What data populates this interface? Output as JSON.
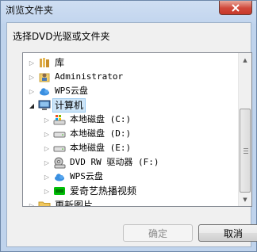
{
  "window": {
    "title": "浏览文件夹",
    "close_icon": "close-x"
  },
  "dialog": {
    "instruction": "选择DVD光驱或文件夹"
  },
  "tree": {
    "items": [
      {
        "label": "库",
        "icon": "library-icon",
        "expanded": false
      },
      {
        "label": "Administrator",
        "icon": "user-folder-icon",
        "expanded": false
      },
      {
        "label": "WPS云盘",
        "icon": "cloud-icon",
        "expanded": false
      },
      {
        "label": "计算机",
        "icon": "computer-icon",
        "expanded": true,
        "selected": true
      },
      {
        "label": "本地磁盘 (C:)",
        "icon": "system-drive-icon",
        "expanded": false
      },
      {
        "label": "本地磁盘 (D:)",
        "icon": "hard-drive-icon",
        "expanded": false
      },
      {
        "label": "本地磁盘 (E:)",
        "icon": "hard-drive-icon",
        "expanded": false
      },
      {
        "label": "DVD RW 驱动器 (F:)",
        "icon": "dvd-drive-icon",
        "expanded": false
      },
      {
        "label": "WPS云盘",
        "icon": "cloud-icon",
        "expanded": false
      },
      {
        "label": "爱奇艺热播视频",
        "icon": "iqiyi-icon",
        "expanded": false
      },
      {
        "label": "更新图片",
        "icon": "folder-icon",
        "expanded": false
      }
    ]
  },
  "buttons": {
    "ok": "确定",
    "cancel": "取消",
    "ok_enabled": false
  },
  "colors": {
    "selection": "#cce4f7",
    "close_button": "#c8392b",
    "frame": "#c2d5ee"
  }
}
